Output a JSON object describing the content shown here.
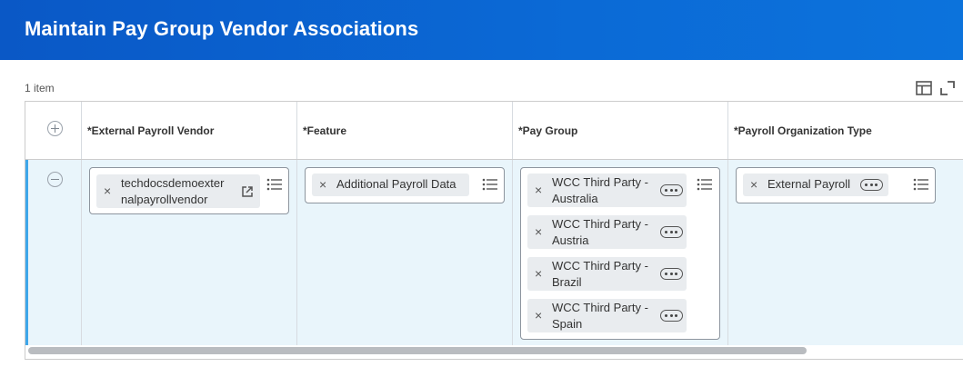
{
  "header": {
    "title": "Maintain Pay Group Vendor Associations"
  },
  "grid": {
    "item_count": "1 item",
    "columns": [
      "*External Payroll Vendor",
      "*Feature",
      "*Pay Group",
      "*Payroll Organization Type"
    ],
    "row": {
      "vendor": {
        "line1": "techdocsdemoexter",
        "line2": "nalpayrollvendor"
      },
      "feature": "Additional Payroll Data",
      "pay_groups": [
        {
          "line1": "WCC Third Party -",
          "line2": "Australia"
        },
        {
          "line1": "WCC Third Party -",
          "line2": "Austria"
        },
        {
          "line1": "WCC Third Party -",
          "line2": "Brazil"
        },
        {
          "line1": "WCC Third Party -",
          "line2": "Spain"
        }
      ],
      "org_type": "External Payroll"
    }
  },
  "icons": {
    "remove": "×"
  }
}
